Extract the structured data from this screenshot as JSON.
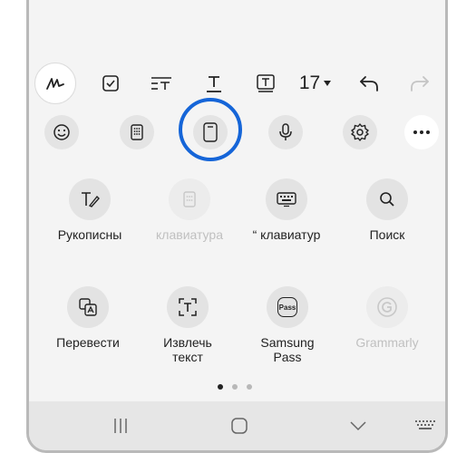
{
  "toolbar": {
    "font_size": "17",
    "items": [
      "pen-icon",
      "checkbox-icon",
      "text-style-icon",
      "underline-text-icon",
      "text-box-icon",
      "undo-icon",
      "redo-icon"
    ]
  },
  "quick_row": {
    "items": [
      "emoji-icon",
      "keyboard-layout-icon",
      "clipboard-icon",
      "microphone-icon",
      "settings-icon",
      "more-icon"
    ]
  },
  "grid": {
    "items": [
      {
        "label": "Рукописны",
        "enabled": true,
        "icon": "handwriting-icon"
      },
      {
        "label": "клавиатура",
        "enabled": false,
        "icon": "keypad-icon"
      },
      {
        "label": "“ клавиатур",
        "enabled": true,
        "icon": "keyboard-icon"
      },
      {
        "label": "Поиск",
        "enabled": true,
        "icon": "search-icon"
      },
      {
        "label": "Перевести",
        "enabled": true,
        "icon": "translate-icon"
      },
      {
        "label": "Извлечь\nтекст",
        "enabled": true,
        "icon": "extract-text-icon"
      },
      {
        "label": "Samsung\nPass",
        "enabled": true,
        "icon": "samsung-pass-icon"
      },
      {
        "label": "Grammarly",
        "enabled": false,
        "icon": "grammarly-icon"
      }
    ],
    "pass_icon_text": "Pass"
  },
  "page_indicator": {
    "count": 3,
    "active": 0
  },
  "navbar": {
    "items": [
      "recents-icon",
      "home-icon",
      "back-icon",
      "keyboard-toggle-icon"
    ]
  },
  "colors": {
    "highlight": "#1565d8"
  }
}
